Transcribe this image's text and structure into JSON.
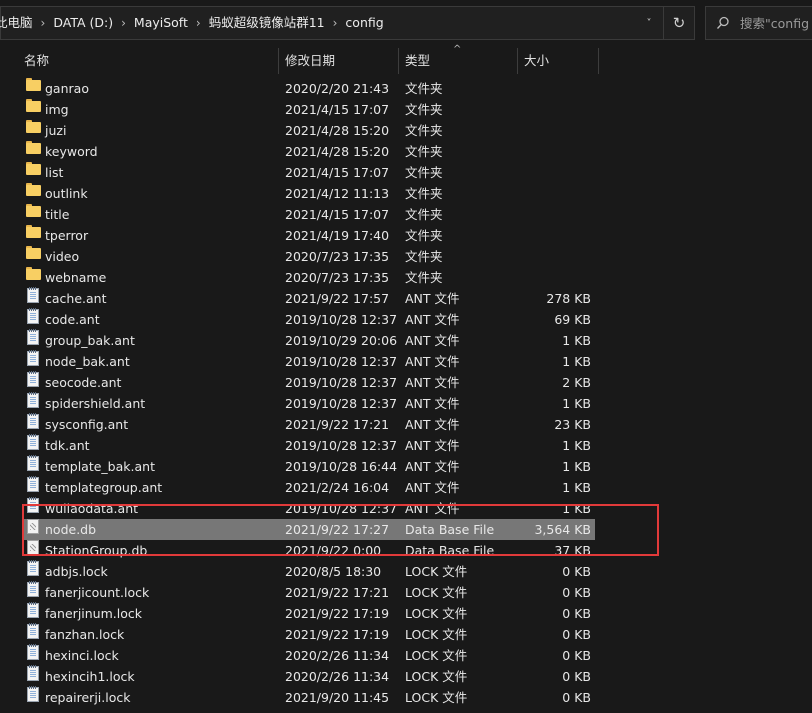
{
  "address_bar": {
    "crumbs": [
      "此电脑",
      "DATA (D:)",
      "MayiSoft",
      "蚂蚁超级镜像站群11",
      "config"
    ],
    "separator": "›",
    "dropdown_glyph": "˅",
    "refresh_glyph": "↻"
  },
  "search": {
    "placeholder": "搜索\"config"
  },
  "columns": {
    "name": "名称",
    "date": "修改日期",
    "type": "类型",
    "size": "大小",
    "sort_glyph": "^"
  },
  "files": [
    {
      "icon": "folder-icon",
      "name": "ganrao",
      "date": "2020/2/20 21:43",
      "type": "文件夹",
      "size": ""
    },
    {
      "icon": "folder-icon",
      "name": "img",
      "date": "2021/4/15 17:07",
      "type": "文件夹",
      "size": ""
    },
    {
      "icon": "folder-icon",
      "name": "juzi",
      "date": "2021/4/28 15:20",
      "type": "文件夹",
      "size": ""
    },
    {
      "icon": "folder-icon",
      "name": "keyword",
      "date": "2021/4/28 15:20",
      "type": "文件夹",
      "size": ""
    },
    {
      "icon": "folder-icon",
      "name": "list",
      "date": "2021/4/15 17:07",
      "type": "文件夹",
      "size": ""
    },
    {
      "icon": "folder-icon",
      "name": "outlink",
      "date": "2021/4/12 11:13",
      "type": "文件夹",
      "size": ""
    },
    {
      "icon": "folder-icon",
      "name": "title",
      "date": "2021/4/15 17:07",
      "type": "文件夹",
      "size": ""
    },
    {
      "icon": "folder-icon",
      "name": "tperror",
      "date": "2021/4/19 17:40",
      "type": "文件夹",
      "size": ""
    },
    {
      "icon": "folder-icon",
      "name": "video",
      "date": "2020/7/23 17:35",
      "type": "文件夹",
      "size": ""
    },
    {
      "icon": "folder-icon",
      "name": "webname",
      "date": "2020/7/23 17:35",
      "type": "文件夹",
      "size": ""
    },
    {
      "icon": "notepad-file-icon",
      "name": "cache.ant",
      "date": "2021/9/22 17:57",
      "type": "ANT 文件",
      "size": "278 KB"
    },
    {
      "icon": "notepad-file-icon",
      "name": "code.ant",
      "date": "2019/10/28 12:37",
      "type": "ANT 文件",
      "size": "69 KB"
    },
    {
      "icon": "notepad-file-icon",
      "name": "group_bak.ant",
      "date": "2019/10/29 20:06",
      "type": "ANT 文件",
      "size": "1 KB"
    },
    {
      "icon": "notepad-file-icon",
      "name": "node_bak.ant",
      "date": "2019/10/28 12:37",
      "type": "ANT 文件",
      "size": "1 KB"
    },
    {
      "icon": "notepad-file-icon",
      "name": "seocode.ant",
      "date": "2019/10/28 12:37",
      "type": "ANT 文件",
      "size": "2 KB"
    },
    {
      "icon": "notepad-file-icon",
      "name": "spidershield.ant",
      "date": "2019/10/28 12:37",
      "type": "ANT 文件",
      "size": "1 KB"
    },
    {
      "icon": "notepad-file-icon",
      "name": "sysconfig.ant",
      "date": "2021/9/22 17:21",
      "type": "ANT 文件",
      "size": "23 KB"
    },
    {
      "icon": "notepad-file-icon",
      "name": "tdk.ant",
      "date": "2019/10/28 12:37",
      "type": "ANT 文件",
      "size": "1 KB"
    },
    {
      "icon": "notepad-file-icon",
      "name": "template_bak.ant",
      "date": "2019/10/28 16:44",
      "type": "ANT 文件",
      "size": "1 KB"
    },
    {
      "icon": "notepad-file-icon",
      "name": "templategroup.ant",
      "date": "2021/2/24 16:04",
      "type": "ANT 文件",
      "size": "1 KB"
    },
    {
      "icon": "notepad-file-icon",
      "name": "wuliaodata.ant",
      "date": "2019/10/28 12:37",
      "type": "ANT 文件",
      "size": "1 KB"
    },
    {
      "icon": "db-file-icon",
      "name": "node.db",
      "date": "2021/9/22 17:27",
      "type": "Data Base File",
      "size": "3,564 KB",
      "selected": true
    },
    {
      "icon": "db-file-icon",
      "name": "StationGroup.db",
      "date": "2021/9/22 0:00",
      "type": "Data Base File",
      "size": "37 KB"
    },
    {
      "icon": "notepad-file-icon",
      "name": "adbjs.lock",
      "date": "2020/8/5 18:30",
      "type": "LOCK 文件",
      "size": "0 KB"
    },
    {
      "icon": "notepad-file-icon",
      "name": "fanerjicount.lock",
      "date": "2021/9/22 17:21",
      "type": "LOCK 文件",
      "size": "0 KB"
    },
    {
      "icon": "notepad-file-icon",
      "name": "fanerjinum.lock",
      "date": "2021/9/22 17:19",
      "type": "LOCK 文件",
      "size": "0 KB"
    },
    {
      "icon": "notepad-file-icon",
      "name": "fanzhan.lock",
      "date": "2021/9/22 17:19",
      "type": "LOCK 文件",
      "size": "0 KB"
    },
    {
      "icon": "notepad-file-icon",
      "name": "hexinci.lock",
      "date": "2020/2/26 11:34",
      "type": "LOCK 文件",
      "size": "0 KB"
    },
    {
      "icon": "notepad-file-icon",
      "name": "hexincih1.lock",
      "date": "2020/2/26 11:34",
      "type": "LOCK 文件",
      "size": "0 KB"
    },
    {
      "icon": "notepad-file-icon",
      "name": "repairerji.lock",
      "date": "2021/9/20 11:45",
      "type": "LOCK 文件",
      "size": "0 KB"
    }
  ],
  "colors": {
    "background": "#191919",
    "selected_row": "#777777",
    "highlight_border": "#e23a3a",
    "folder": "#f8cf63"
  }
}
